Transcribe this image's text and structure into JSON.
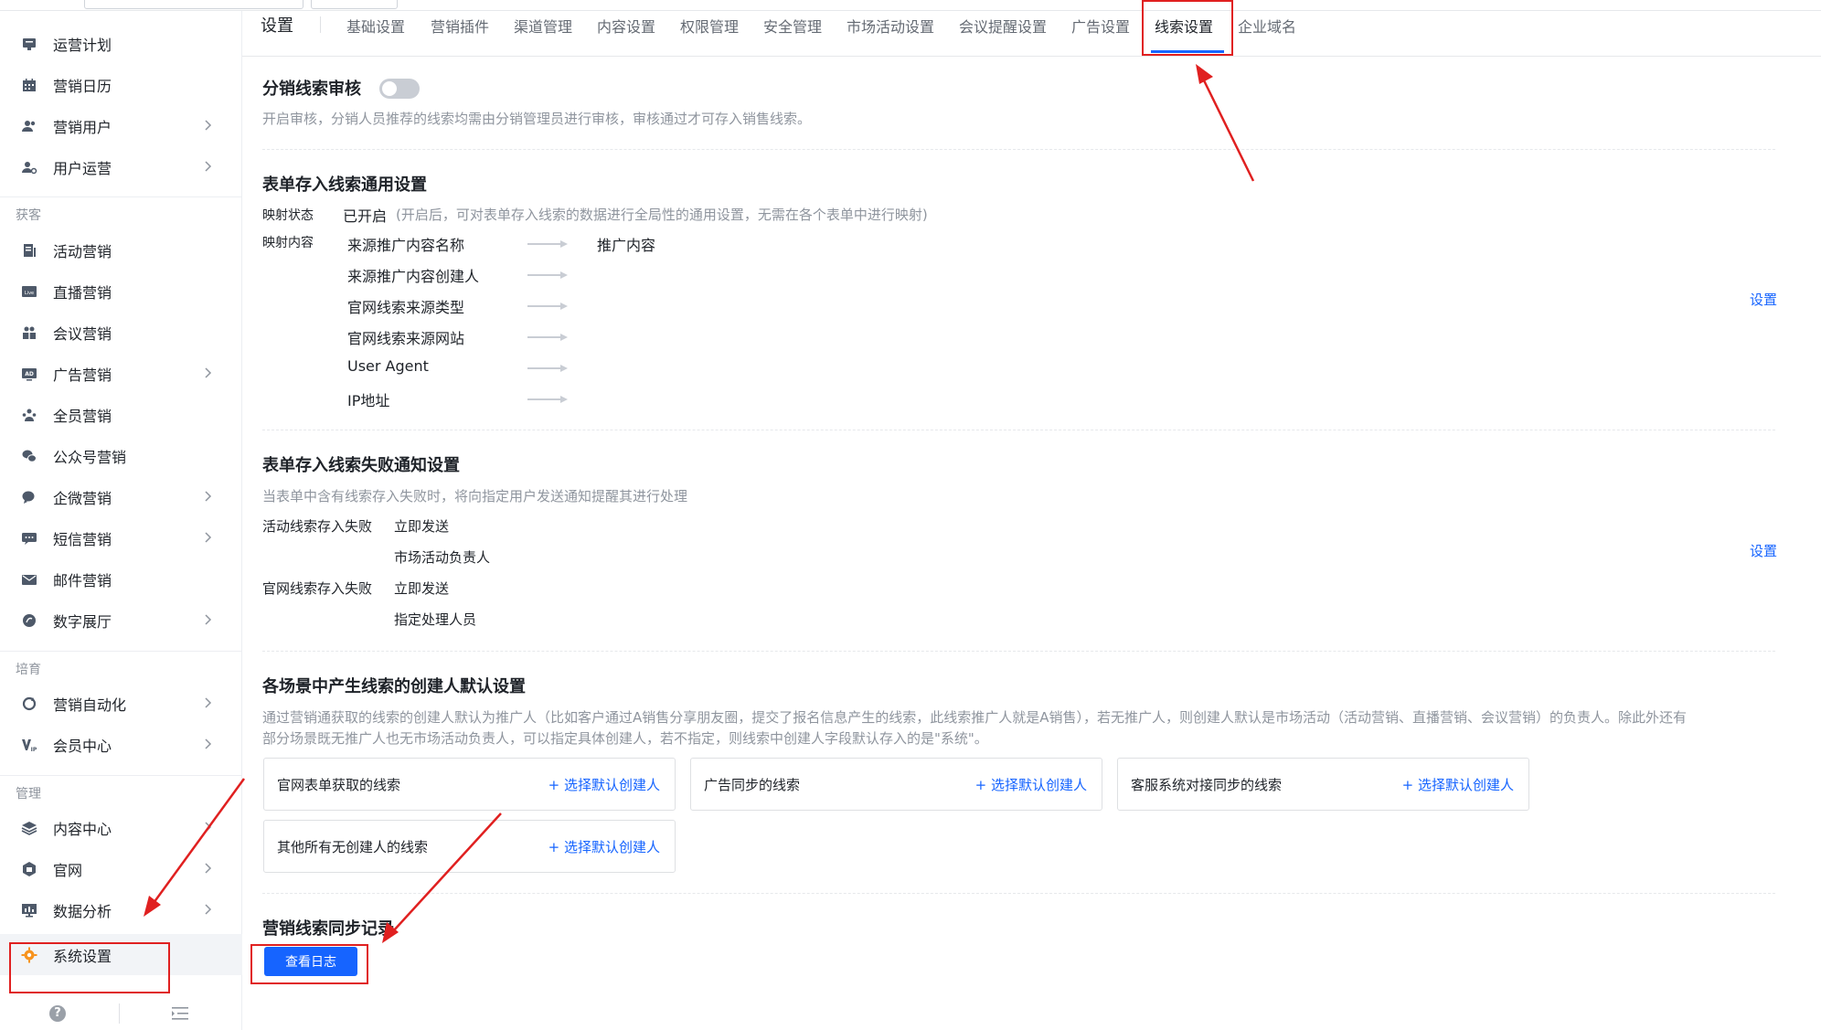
{
  "sidebar": {
    "items": [
      {
        "label": "运营计划",
        "icon": "plan-icon"
      },
      {
        "label": "营销日历",
        "icon": "calendar-icon"
      },
      {
        "label": "营销用户",
        "icon": "users-icon"
      },
      {
        "label": "用户运营",
        "icon": "user-ops-icon"
      },
      {
        "label": "活动营销",
        "icon": "activity-icon"
      },
      {
        "label": "直播营销",
        "icon": "live-icon"
      },
      {
        "label": "会议营销",
        "icon": "meeting-icon"
      },
      {
        "label": "广告营销",
        "icon": "ad-icon"
      },
      {
        "label": "全员营销",
        "icon": "all-staff-icon"
      },
      {
        "label": "公众号营销",
        "icon": "wechat-icon"
      },
      {
        "label": "企微营销",
        "icon": "wecom-icon"
      },
      {
        "label": "短信营销",
        "icon": "sms-icon"
      },
      {
        "label": "邮件营销",
        "icon": "mail-icon"
      },
      {
        "label": "数字展厅",
        "icon": "showroom-icon"
      },
      {
        "label": "营销自动化",
        "icon": "automation-icon"
      },
      {
        "label": "会员中心",
        "icon": "vip-icon"
      },
      {
        "label": "内容中心",
        "icon": "content-icon"
      },
      {
        "label": "官网",
        "icon": "website-icon"
      },
      {
        "label": "数据分析",
        "icon": "analytics-icon"
      },
      {
        "label": "系统设置",
        "icon": "gear-icon"
      }
    ],
    "groups": {
      "acquire": "获客",
      "nurture": "培育",
      "manage": "管理"
    }
  },
  "tabs": {
    "title": "设置",
    "items": [
      "基础设置",
      "营销插件",
      "渠道管理",
      "内容设置",
      "权限管理",
      "安全管理",
      "市场活动设置",
      "会议提醒设置",
      "广告设置",
      "线索设置",
      "企业域名"
    ],
    "active": "线索设置"
  },
  "audit": {
    "title": "分销线索审核",
    "desc": "开启审核，分销人员推荐的线索均需由分销管理员进行审核，审核通过才可存入销售线索。"
  },
  "mapping": {
    "title": "表单存入线索通用设置",
    "status_label": "映射状态",
    "status_value": "已开启",
    "status_hint": "(开启后，可对表单存入线索的数据进行全局性的通用设置，无需在各个表单中进行映射)",
    "content_label": "映射内容",
    "sources": [
      "来源推广内容名称",
      "来源推广内容创建人",
      "官网线索来源类型",
      "官网线索来源网站",
      "User Agent",
      "IP地址"
    ],
    "target": "推广内容",
    "setting_link": "设置"
  },
  "fail_notify": {
    "title": "表单存入线索失败通知设置",
    "desc": "当表单中含有线索存入失败时，将向指定用户发送通知提醒其进行处理",
    "rows": [
      {
        "label": "活动线索存入失败",
        "v1": "立即发送",
        "v2": "市场活动负责人"
      },
      {
        "label": "官网线索存入失败",
        "v1": "立即发送",
        "v2": "指定处理人员"
      }
    ],
    "setting_link": "设置"
  },
  "creator": {
    "title": "各场景中产生线索的创建人默认设置",
    "desc1": "通过营销通获取的线索的创建人默认为推广人（比如客户通过A销售分享朋友圈，提交了报名信息产生的线索，此线索推广人就是A销售），若无推广人，则创建人默认是市场活动（活动营销、直播营销、会议营销）的负责人。除此外还有",
    "desc2": "部分场景既无推广人也无市场活动负责人，可以指定具体创建人，若不指定，则线索中创建人字段默认存入的是\"系统\"。",
    "cards": [
      "官网表单获取的线索",
      "广告同步的线索",
      "客服系统对接同步的线索",
      "其他所有无创建人的线索"
    ],
    "action": "+ 选择默认创建人"
  },
  "sync": {
    "title": "营销线索同步记录",
    "button": "查看日志"
  },
  "colors": {
    "accent": "#1664ff",
    "annotation": "#e02020"
  }
}
